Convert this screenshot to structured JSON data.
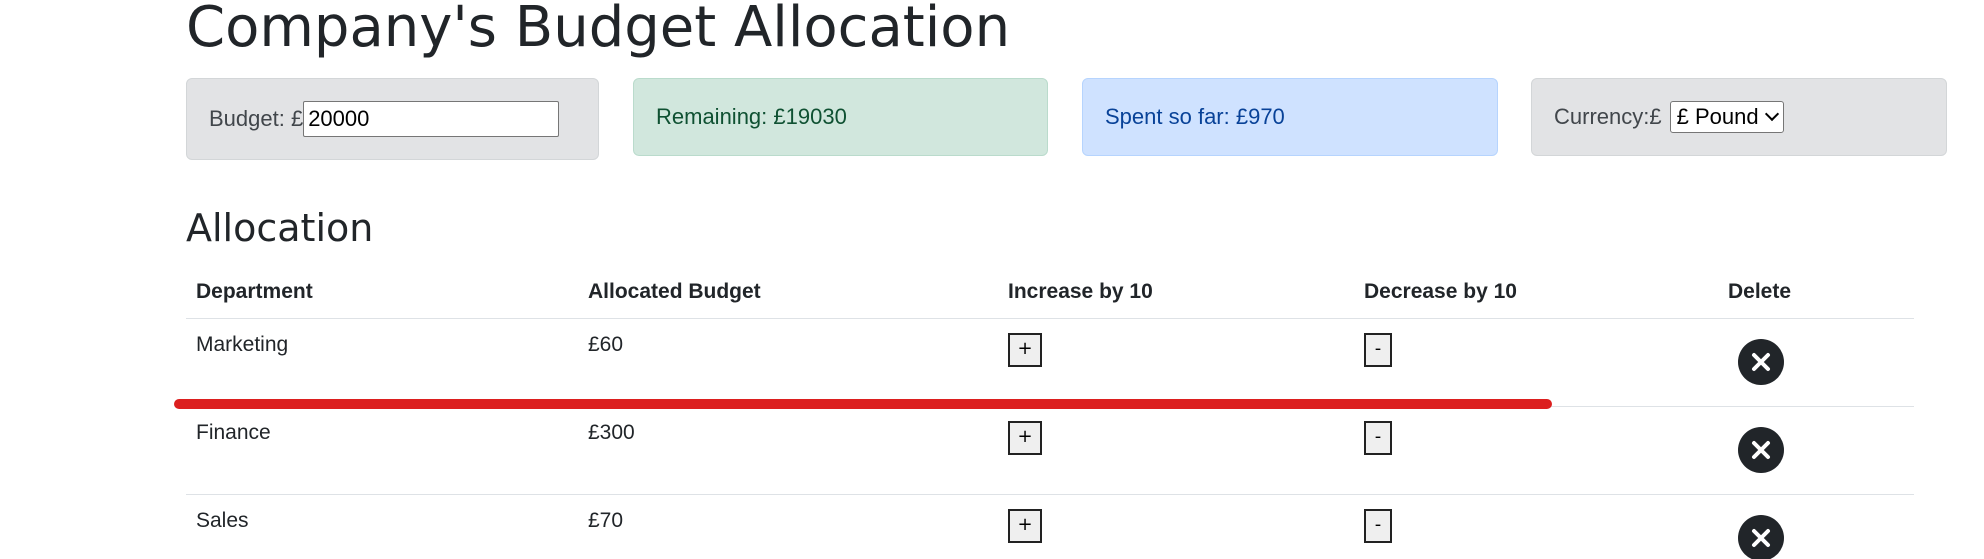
{
  "header": {
    "title": "Company's Budget Allocation"
  },
  "summary": {
    "budget_label": "Budget: £",
    "budget_value": "20000",
    "remaining": "Remaining: £19030",
    "spent": "Spent so far: £970",
    "currency_label": "Currency:£",
    "currency_selected": "£ Pound"
  },
  "allocation": {
    "title": "Allocation",
    "columns": [
      "Department",
      "Allocated Budget",
      "Increase by 10",
      "Decrease by 10",
      "Delete"
    ],
    "rows": [
      {
        "department": "Marketing",
        "budget": "£60"
      },
      {
        "department": "Finance",
        "budget": "£300"
      },
      {
        "department": "Sales",
        "budget": "£70"
      }
    ],
    "increase_label": "+",
    "decrease_label": "-"
  },
  "colors": {
    "annotation_line": "#dc1f1f",
    "remaining_bg": "#d1e7dd",
    "spent_bg": "#cfe2ff",
    "neutral_bg": "#e2e3e5"
  },
  "icons": {
    "delete": "close-circle-icon"
  }
}
